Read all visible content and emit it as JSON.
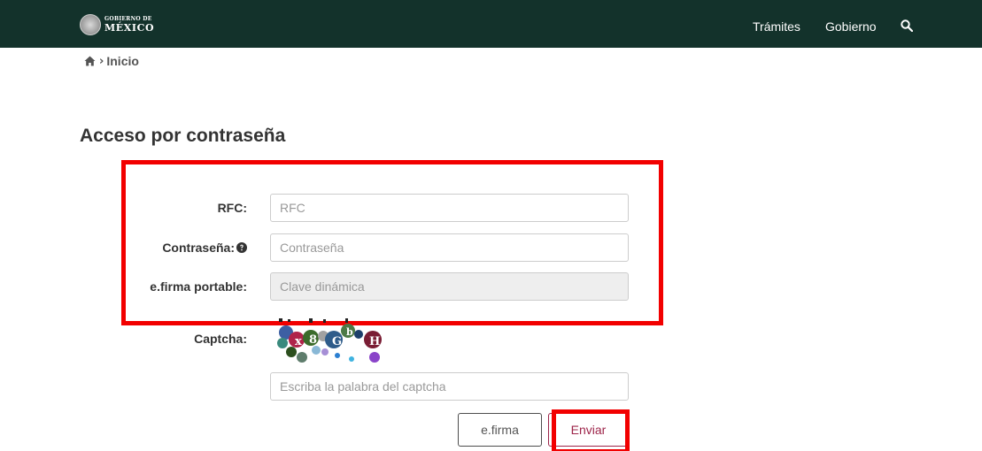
{
  "header": {
    "logo_small": "GOBIERNO DE",
    "logo_big": "MÉXICO",
    "nav": [
      {
        "label": "Trámites"
      },
      {
        "label": "Gobierno"
      }
    ],
    "search_icon": "search-icon",
    "background_color": "#13322b"
  },
  "breadcrumb": {
    "separator": "›",
    "current": "Inicio"
  },
  "page": {
    "title": "Acceso por contraseña"
  },
  "form": {
    "rfc": {
      "label": "RFC:",
      "placeholder": "RFC",
      "value": ""
    },
    "password": {
      "label": "Contraseña:",
      "placeholder": "Contraseña",
      "value": "",
      "help_icon": "question-circle-icon"
    },
    "efirma_portable": {
      "label": "e.firma portable:",
      "placeholder": "Clave dinámica",
      "value": ""
    },
    "captcha": {
      "label": "Captcha:",
      "placeholder": "Escriba la palabra del captcha",
      "value": ""
    }
  },
  "buttons": {
    "efirma": "e.firma",
    "enviar": "Enviar"
  },
  "colors": {
    "highlight": "#f20000",
    "accent": "#9d2449"
  }
}
